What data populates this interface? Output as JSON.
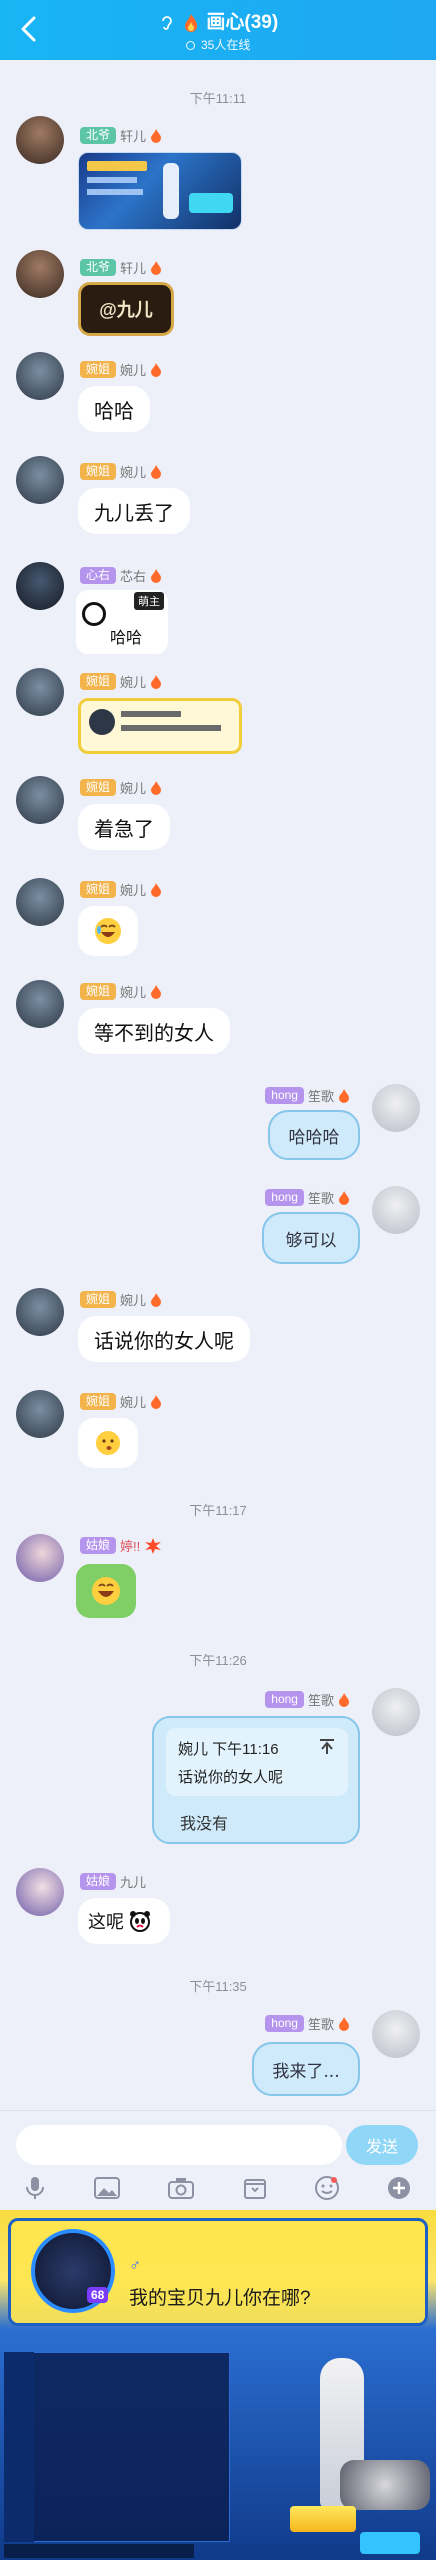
{
  "header": {
    "title": "画心(39)",
    "online": "35人在线"
  },
  "times": [
    "下午11:11",
    "下午11:17",
    "下午11:26",
    "下午11:35"
  ],
  "messages": {
    "m1": {
      "badge": "北爷",
      "name": "轩儿"
    },
    "m2": {
      "badge": "北爷",
      "name": "轩儿",
      "sticker_text": "@九儿"
    },
    "m3": {
      "badge": "婉姐",
      "name": "婉儿",
      "text": "哈哈"
    },
    "m4": {
      "badge": "婉姐",
      "name": "婉儿",
      "text": "九儿丢了"
    },
    "m5": {
      "badge": "心右",
      "name": "芯右",
      "sticker_text": "哈哈",
      "sticker_tag": "萌主"
    },
    "m6": {
      "badge": "婉姐",
      "name": "婉儿"
    },
    "m7": {
      "badge": "婉姐",
      "name": "婉儿",
      "text": "着急了"
    },
    "m8": {
      "badge": "婉姐",
      "name": "婉儿"
    },
    "m9": {
      "badge": "婉姐",
      "name": "婉儿",
      "text": "等不到的女人"
    },
    "m10": {
      "badge": "hong",
      "name": "笙歌",
      "art_text": "哈哈哈"
    },
    "m11": {
      "badge": "hong",
      "name": "笙歌",
      "art_text": "够可以"
    },
    "m12": {
      "badge": "婉姐",
      "name": "婉儿",
      "text": "话说你的女人呢"
    },
    "m13": {
      "badge": "婉姐",
      "name": "婉儿"
    },
    "m14": {
      "badge": "姑娘",
      "name": "婷!!"
    },
    "m15": {
      "badge": "hong",
      "name": "笙歌",
      "quote_header": "婉儿 下午11:16",
      "quote_text": "话说你的女人呢",
      "reply": "我没有"
    },
    "m16": {
      "badge": "姑娘",
      "name": "九儿",
      "text": "这呢"
    },
    "m17": {
      "badge": "hong",
      "name": "笙歌",
      "art_text": "我来了..."
    }
  },
  "input": {
    "send_label": "发送"
  },
  "game": {
    "question": "我的宝贝九儿你在哪?",
    "level": "68"
  },
  "colors": {
    "header": "#18b5f3",
    "bg": "#eef0f9",
    "send": "#8fd6f7"
  }
}
